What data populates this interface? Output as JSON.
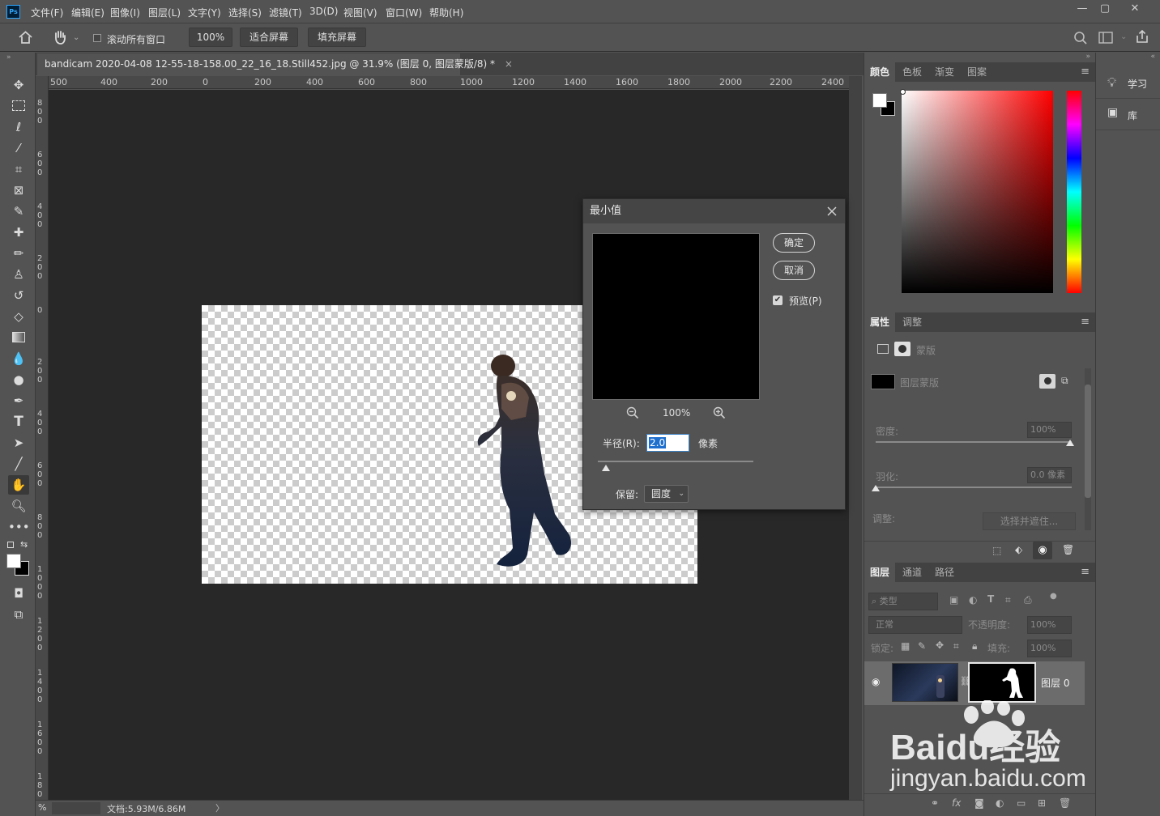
{
  "app": {
    "logo": "Ps"
  },
  "menu": [
    "文件(F)",
    "编辑(E)",
    "图像(I)",
    "图层(L)",
    "文字(Y)",
    "选择(S)",
    "滤镜(T)",
    "3D(D)",
    "视图(V)",
    "窗口(W)",
    "帮助(H)"
  ],
  "window_controls": {
    "minimize": "—",
    "maximize": "▢",
    "close": "✕"
  },
  "options": {
    "scroll_all_label": "滚动所有窗口",
    "zoom_value": "100%",
    "fit_screen": "适合屏幕",
    "fill_screen": "填充屏幕"
  },
  "document": {
    "tab_title": "bandicam 2020-04-08 12-55-18-158.00_22_16_18.Still452.jpg @ 31.9% (图层 0, 图层蒙版/8) *",
    "tab_close": "×"
  },
  "rulers": {
    "h": [
      "500",
      "400",
      "200",
      "0",
      "200",
      "400",
      "600",
      "800",
      "1000",
      "1200",
      "1400",
      "1600",
      "1800",
      "2000",
      "2200",
      "2400"
    ],
    "v": [
      "800",
      "600",
      "400",
      "200",
      "0",
      "200",
      "400",
      "600",
      "800",
      "1000",
      "1200",
      "1400",
      "1600",
      "1800"
    ]
  },
  "status": {
    "doc_size": "文档:5.93M/6.86M",
    "unit": "%",
    "arrow": "〉"
  },
  "dialog": {
    "title": "最小值",
    "ok": "确定",
    "cancel": "取消",
    "preview_label": "预览(P)",
    "zoom_level": "100%",
    "radius_label": "半径(R):",
    "radius_value": "2.0",
    "radius_unit": "像素",
    "radius_fraction": 0.05,
    "preserve_label": "保留:",
    "preserve_value": "圆度"
  },
  "color_panel": {
    "tabs": [
      "颜色",
      "色板",
      "渐变",
      "图案"
    ]
  },
  "properties_panel": {
    "tabs": [
      "属性",
      "调整"
    ],
    "mask_type": "蒙版",
    "layer_mask": "图层蒙版",
    "density_label": "密度:",
    "density_value": "100%",
    "feather_label": "羽化:",
    "feather_value": "0.0 像素",
    "adjust_label": "调整:",
    "select_mask_btn": "选择并遮住..."
  },
  "layers_panel": {
    "tabs": [
      "图层",
      "通道",
      "路径"
    ],
    "filter_kind": "类型",
    "blend_mode": "正常",
    "opacity_label": "不透明度:",
    "opacity_value": "100%",
    "lock_label": "锁定:",
    "fill_label": "填充:",
    "fill_value": "100%",
    "layer_name": "图层 0"
  },
  "side_panels": {
    "learn": "学习",
    "library": "库"
  },
  "watermark": {
    "brand": "Baidu经验",
    "url": "jingyan.baidu.com"
  },
  "colors": {
    "accent": "#31a8ff",
    "canvas": "#282828",
    "panel": "#535353"
  }
}
